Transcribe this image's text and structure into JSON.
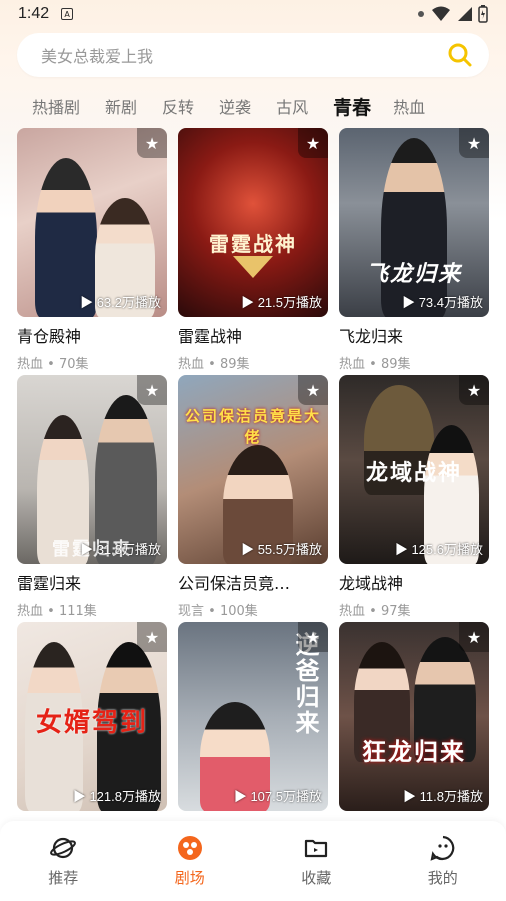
{
  "status_bar": {
    "time": "1:42",
    "notification_letter": "A"
  },
  "search": {
    "placeholder": "美女总裁爱上我",
    "icon": "search-icon",
    "accent": "#f5c400"
  },
  "tabs": [
    {
      "label": "热播剧"
    },
    {
      "label": "新剧"
    },
    {
      "label": "反转"
    },
    {
      "label": "逆袭"
    },
    {
      "label": "古风"
    },
    {
      "label": "青春",
      "active": true
    },
    {
      "label": "热血"
    }
  ],
  "dramas": [
    {
      "title": "青仓殿神",
      "tag": "热血",
      "episodes": "70集",
      "plays": "▶ 63.2万播放",
      "poster_text": ""
    },
    {
      "title": "雷霆战神",
      "tag": "热血",
      "episodes": "89集",
      "plays": "▶ 21.5万播放",
      "poster_text": "雷霆战神"
    },
    {
      "title": "飞龙归来",
      "tag": "热血",
      "episodes": "89集",
      "plays": "▶ 73.4万播放",
      "poster_text": "飞龙归来"
    },
    {
      "title": "雷霆归来",
      "tag": "热血",
      "episodes": "111集",
      "plays": "▶ 31.8万播放",
      "poster_text": "雷霆归来"
    },
    {
      "title": "公司保洁员竟…",
      "tag": "现言",
      "episodes": "100集",
      "plays": "▶ 55.5万播放",
      "poster_text": "公司保洁员竟是大佬"
    },
    {
      "title": "龙域战神",
      "tag": "热血",
      "episodes": "97集",
      "plays": "▶ 125.6万播放",
      "poster_text": "龙域战神"
    },
    {
      "title": "",
      "tag": "",
      "episodes": "",
      "plays": "▶ 121.8万播放",
      "poster_text": "女婿驾到"
    },
    {
      "title": "",
      "tag": "",
      "episodes": "",
      "plays": "▶ 107.5万播放",
      "poster_text": "逆爸归来"
    },
    {
      "title": "",
      "tag": "",
      "episodes": "",
      "plays": "▶ 11.8万播放",
      "poster_text": "狂龙归来"
    }
  ],
  "meta_separator": " • ",
  "bottom_nav": [
    {
      "label": "推荐",
      "icon": "planet-icon"
    },
    {
      "label": "剧场",
      "icon": "theater-icon",
      "active": true
    },
    {
      "label": "收藏",
      "icon": "folder-icon"
    },
    {
      "label": "我的",
      "icon": "smile-icon"
    }
  ],
  "colors": {
    "accent": "#f4661c",
    "search_icon": "#f5c400"
  }
}
